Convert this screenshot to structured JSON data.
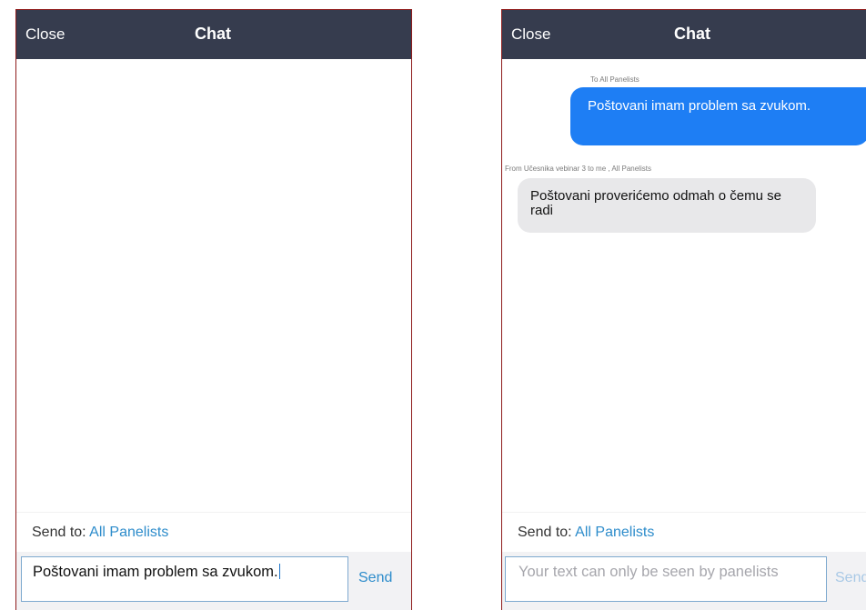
{
  "left_phone": {
    "header": {
      "close_label": "Close",
      "title": "Chat"
    },
    "send_to": {
      "prefix": "Send to:",
      "recipient": "All Panelists"
    },
    "input": {
      "value": "Poštovani imam problem sa zvukom."
    },
    "send_label": "Send"
  },
  "right_phone": {
    "header": {
      "close_label": "Close",
      "title": "Chat"
    },
    "messages": [
      {
        "meta": "To All Panelists",
        "text": "Poštovani imam problem sa zvukom.",
        "direction": "outgoing"
      },
      {
        "meta": "From Učesnika vebinar 3 to me , All Panelists",
        "text": "Poštovani proverićemo odmah o čemu se radi",
        "direction": "incoming"
      }
    ],
    "send_to": {
      "prefix": "Send to:",
      "recipient": "All Panelists"
    },
    "input": {
      "placeholder": "Your text can only be seen by panelists"
    },
    "send_label": "Send"
  },
  "colors": {
    "header_bg": "#363c4e",
    "accent_blue": "#2d8ccb",
    "outgoing_bubble": "#1e7ef4",
    "incoming_bubble": "#e8e8ea",
    "frame_border": "#8e1b1b"
  },
  "icons": []
}
